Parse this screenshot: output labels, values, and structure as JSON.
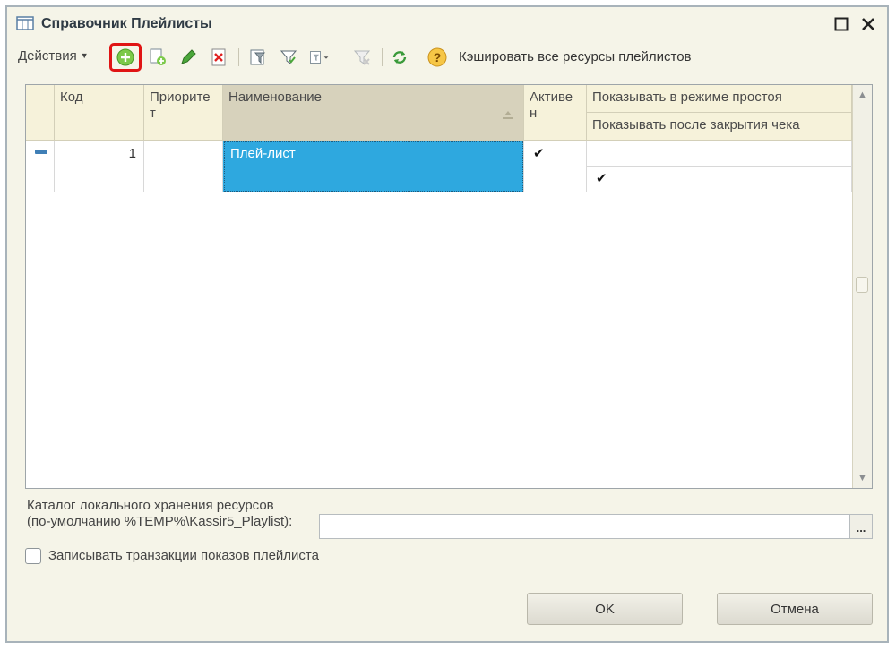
{
  "window": {
    "title": "Справочник Плейлисты"
  },
  "toolbar": {
    "actions_label": "Действия",
    "cache_label": "Кэшировать все ресурсы плейлистов",
    "icons": [
      "add-icon",
      "copy-icon",
      "edit-icon",
      "delete-icon",
      "filter-icon",
      "filter-select-icon",
      "filter-list-icon",
      "filter-clear-icon",
      "refresh-icon",
      "help-icon"
    ]
  },
  "grid": {
    "columns": {
      "code": "Код",
      "priority": "Приорите т",
      "name": "Наименование",
      "active": "Активе н",
      "show_idle": "Показывать в режиме простоя",
      "show_after_check": "Показывать после закрытия чека"
    },
    "rows": [
      {
        "code": "1",
        "priority": "",
        "name": "Плей-лист",
        "active": "✔",
        "show_idle": "",
        "show_after_check": "✔"
      }
    ]
  },
  "storage": {
    "label_line1": "Каталог локального хранения ресурсов",
    "label_line2": "(по-умолчанию %TEMP%\\Kassir5_Playlist):",
    "value": "",
    "browse_label": "..."
  },
  "options": {
    "log_transactions_label": "Записывать транзакции показов плейлиста"
  },
  "buttons": {
    "ok": "OK",
    "cancel": "Отмена"
  },
  "colors": {
    "selection": "#2ea8df",
    "header_bg": "#f6f2da",
    "highlight": "#e01414"
  }
}
